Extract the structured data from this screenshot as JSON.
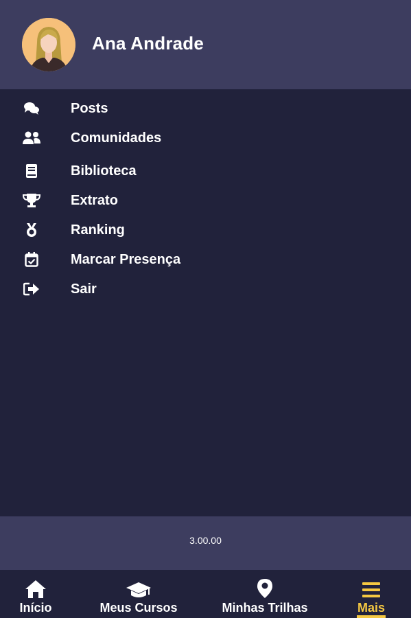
{
  "user": {
    "name": "Ana Andrade",
    "avatar_icon": "female-avatar-icon"
  },
  "menu": {
    "items": [
      {
        "label": "Posts",
        "icon": "comments-icon"
      },
      {
        "label": "Comunidades",
        "icon": "users-icon"
      },
      {
        "label": "Biblioteca",
        "icon": "book-icon"
      },
      {
        "label": "Extrato",
        "icon": "trophy-icon"
      },
      {
        "label": "Ranking",
        "icon": "medal-icon"
      },
      {
        "label": "Marcar Presença",
        "icon": "calendar-check-icon"
      },
      {
        "label": "Sair",
        "icon": "sign-out-icon"
      }
    ]
  },
  "footer": {
    "version": "3.00.00"
  },
  "bottom_nav": {
    "items": [
      {
        "label": "Início",
        "icon": "home-icon"
      },
      {
        "label": "Meus Cursos",
        "icon": "graduation-cap-icon"
      },
      {
        "label": "Minhas Trilhas",
        "icon": "map-marker-icon"
      },
      {
        "label": "Mais",
        "icon": "hamburger-menu-icon",
        "active": true
      }
    ]
  },
  "colors": {
    "header_bg": "#3d3d5f",
    "body_bg": "#21223b",
    "accent": "#f5c842",
    "text": "#ffffff"
  }
}
